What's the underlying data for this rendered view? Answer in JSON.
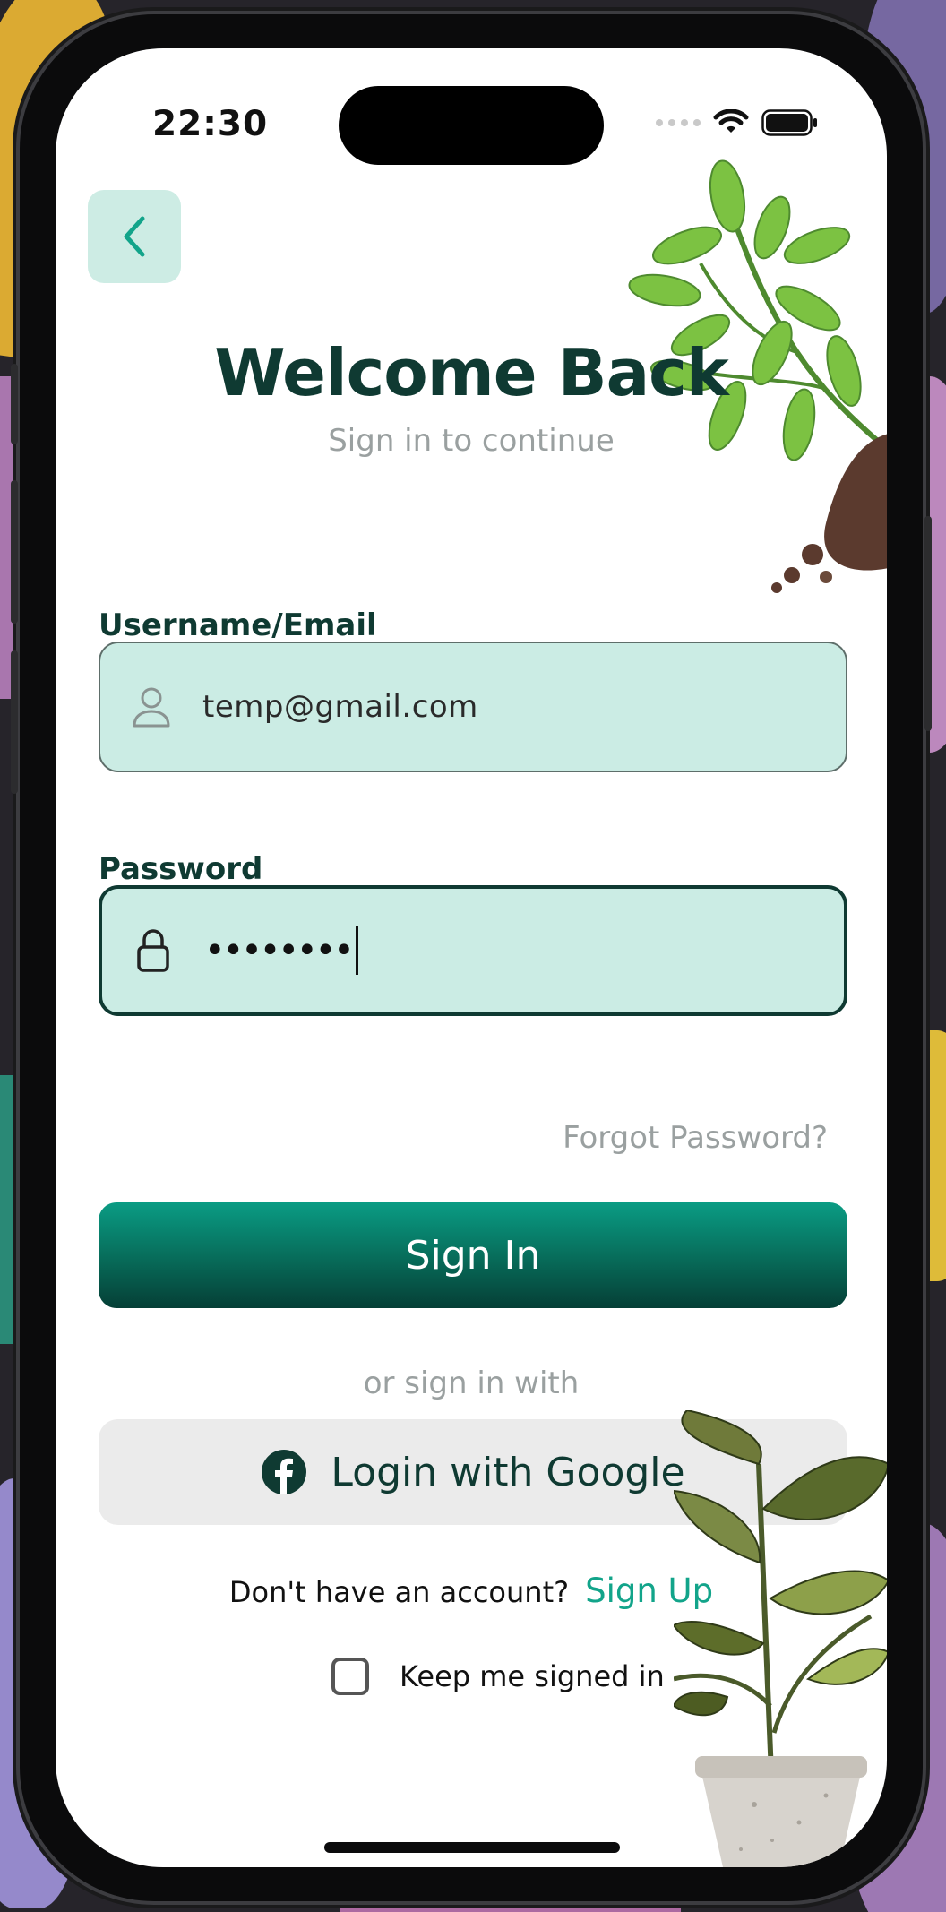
{
  "status_bar": {
    "time": "22:30"
  },
  "header": {
    "title": "Welcome Back",
    "subtitle": "Sign in to continue"
  },
  "form": {
    "email": {
      "label": "Username/Email",
      "value": "temp@gmail.com"
    },
    "password": {
      "label": "Password",
      "value": "••••••••"
    },
    "forgot_label": "Forgot Password?",
    "signin_label": "Sign In",
    "or_label": "or sign in with",
    "google_label": "Login with Google",
    "signup_prompt": "Don't have an account?",
    "signup_link": "Sign Up",
    "keep_signed_in": {
      "label": "Keep me signed in",
      "checked": false
    }
  },
  "icons": {
    "back": "chevron-left-icon",
    "user": "user-icon",
    "lock": "lock-icon",
    "social": "facebook-icon",
    "wifi": "wifi-icon",
    "battery": "battery-icon"
  },
  "colors": {
    "primary_dark": "#0f3a32",
    "accent": "#12a48a",
    "field_bg": "#cbece4",
    "muted": "#9aa0a0"
  }
}
